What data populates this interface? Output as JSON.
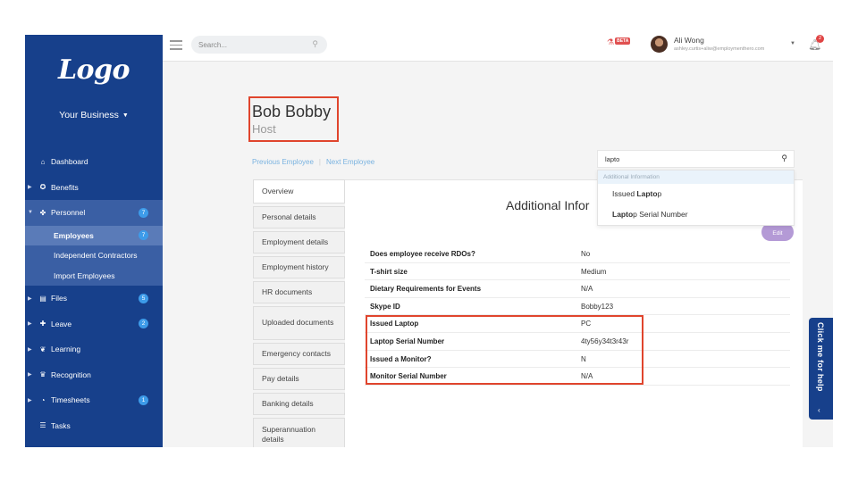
{
  "sidebar": {
    "logo": "Logo",
    "business": "Your Business",
    "items": [
      {
        "label": "Dashboard",
        "icon": "home-icon",
        "glyph": "⌂",
        "arrow": ""
      },
      {
        "label": "Benefits",
        "icon": "benefits-icon",
        "glyph": "✪",
        "arrow": "▶"
      },
      {
        "label": "Personnel",
        "icon": "personnel-icon",
        "glyph": "✤",
        "arrow": "▼",
        "badge": "7"
      }
    ],
    "personnel_sub": [
      {
        "label": "Employees",
        "badge": "7"
      },
      {
        "label": "Independent Contractors"
      },
      {
        "label": "Import Employees"
      }
    ],
    "items_after": [
      {
        "label": "Files",
        "icon": "files-icon",
        "glyph": "▤",
        "arrow": "▶",
        "badge": "5"
      },
      {
        "label": "Leave",
        "icon": "leave-icon",
        "glyph": "✚",
        "arrow": "▶",
        "badge": "2"
      },
      {
        "label": "Learning",
        "icon": "learning-icon",
        "glyph": "❦",
        "arrow": "▶"
      },
      {
        "label": "Recognition",
        "icon": "recognition-icon",
        "glyph": "♛",
        "arrow": "▶"
      },
      {
        "label": "Timesheets",
        "icon": "timesheets-icon",
        "glyph": "◔",
        "arrow": "▶",
        "badge": "1"
      },
      {
        "label": "Tasks",
        "icon": "tasks-icon",
        "glyph": "☰",
        "arrow": ""
      }
    ]
  },
  "topbar": {
    "search_placeholder": "Search...",
    "beta_label": "BETA",
    "user_name": "Ali Wong",
    "user_email": "ashley.curtis+aliw@employmenthero.com",
    "notification_count": "2"
  },
  "employee": {
    "name": "Bob Bobby",
    "role": "Host",
    "prev_label": "Previous Employee",
    "next_label": "Next Employee"
  },
  "tabs": [
    {
      "label": "Overview",
      "active": true,
      "h": 27
    },
    {
      "label": "Personal details",
      "h": 25
    },
    {
      "label": "Employment details",
      "h": 25
    },
    {
      "label": "Employment history",
      "h": 25
    },
    {
      "label": "HR documents",
      "h": 25
    },
    {
      "label": "Uploaded documents",
      "h": 38
    },
    {
      "label": "Emergency contacts",
      "h": 25
    },
    {
      "label": "Pay details",
      "h": 25
    },
    {
      "label": "Banking details",
      "h": 25
    },
    {
      "label": "Superannuation details",
      "h": 38
    }
  ],
  "panel": {
    "title": "Additional Infor",
    "edit_label": "Edit",
    "rows": [
      {
        "label": "Does employee receive RDOs?",
        "value": "No"
      },
      {
        "label": "T-shirt size",
        "value": "Medium"
      },
      {
        "label": "Dietary Requirements for Events",
        "value": "N/A"
      },
      {
        "label": "Skype ID",
        "value": "Bobby123"
      },
      {
        "label": "Issued Laptop",
        "value": "PC"
      },
      {
        "label": "Laptop Serial Number",
        "value": "4ty56y34t3r43r"
      },
      {
        "label": "Issued a Monitor?",
        "value": "N"
      },
      {
        "label": "Monitor Serial Number",
        "value": "N/A"
      }
    ]
  },
  "field_search": {
    "value": "lapto",
    "dropdown_header": "Additional Information",
    "results": [
      {
        "pre": "Issued ",
        "match": "Lapto",
        "post": "p"
      },
      {
        "pre": "",
        "match": "Lapto",
        "post": "p Serial Number"
      }
    ]
  },
  "help": {
    "label": "Click me for help",
    "chevron": "‹"
  },
  "colors": {
    "sidebar": "#17408b",
    "highlight": "#e0452d",
    "link": "#7ab3e0",
    "edit_button": "#b49ad6"
  }
}
